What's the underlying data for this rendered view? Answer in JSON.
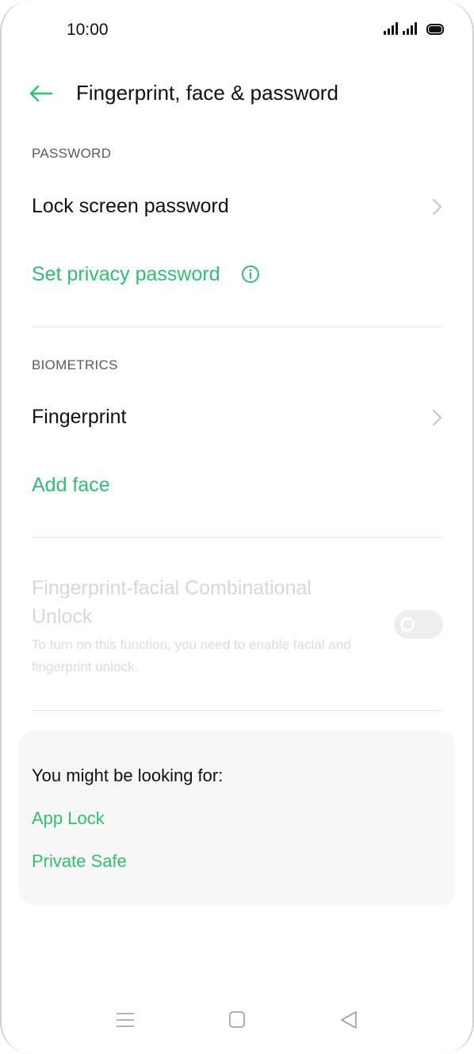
{
  "status_bar": {
    "time": "10:00",
    "icons": [
      "signal-icon",
      "signal-icon",
      "battery-icon"
    ]
  },
  "header": {
    "back_icon": "back-arrow-icon",
    "title": "Fingerprint, face & password"
  },
  "password_section": {
    "label": "PASSWORD",
    "lock_screen_password": "Lock screen password",
    "set_privacy_password": "Set privacy password"
  },
  "biometrics_section": {
    "label": "BIOMETRICS",
    "fingerprint": "Fingerprint",
    "add_face": "Add face"
  },
  "combo_unlock": {
    "title": "Fingerprint-facial Combinational Unlock",
    "description": "To turn on this function, you need to enable facial and fingerprint unlock.",
    "enabled": false
  },
  "suggestions": {
    "title": "You might be looking for:",
    "links": [
      "App Lock",
      "Private Safe"
    ]
  },
  "navbar": {
    "icons": [
      "menu-icon",
      "home-icon",
      "back-icon"
    ]
  },
  "colors": {
    "accent": "#2fbf71",
    "text": "#111111",
    "disabled_text": "#d7d7d7"
  }
}
